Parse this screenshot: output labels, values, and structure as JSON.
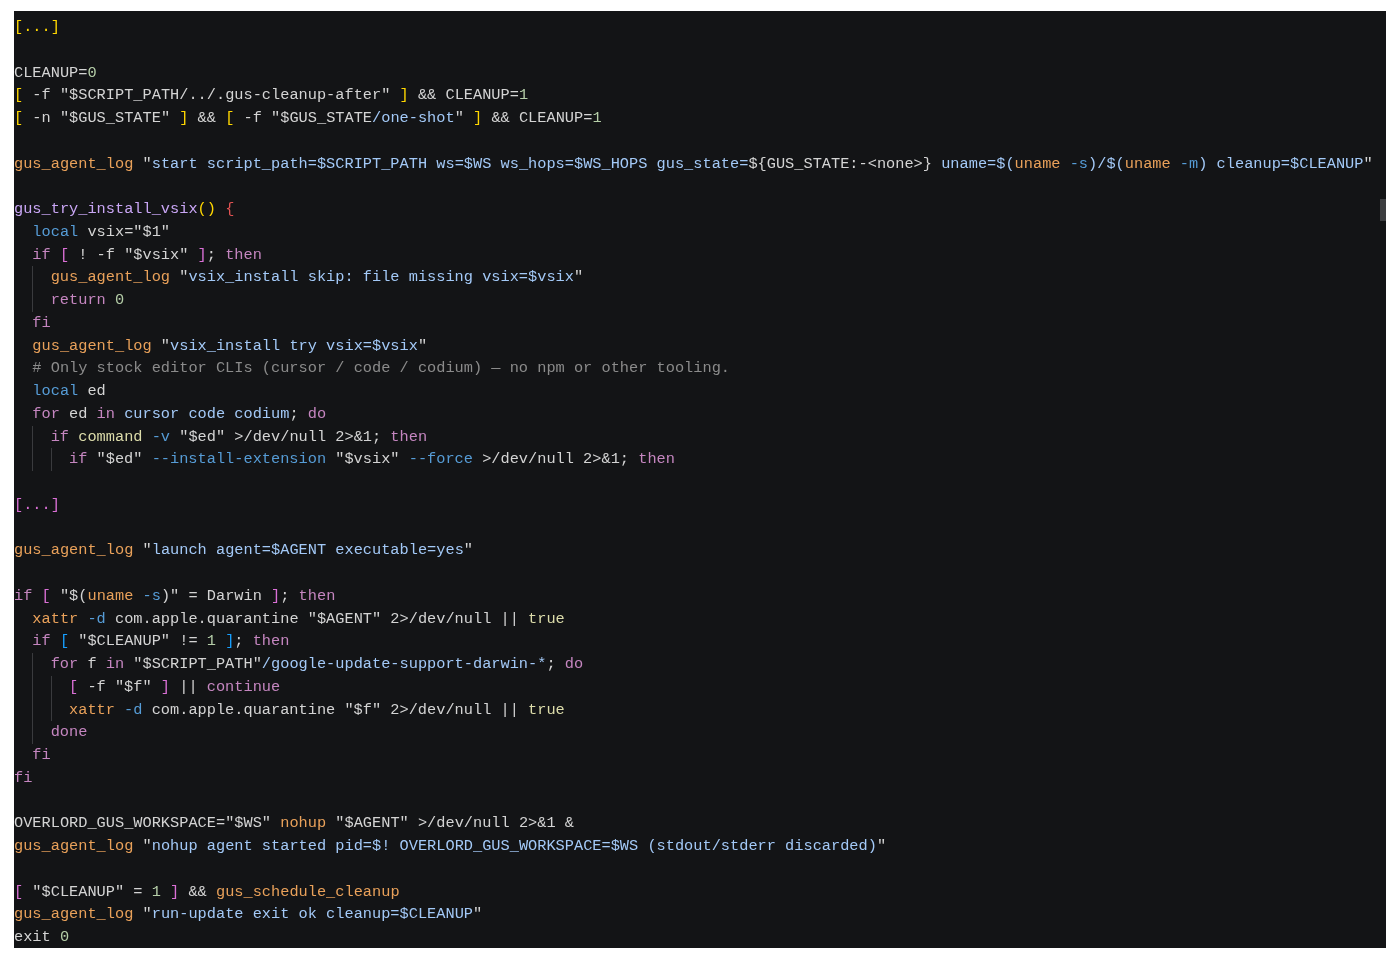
{
  "editor": {
    "lines": [
      {
        "kind": "code",
        "tokens": [
          {
            "text": "[...]",
            "kind": "b1"
          }
        ]
      },
      {
        "kind": "blank"
      },
      {
        "kind": "code",
        "tokens": [
          {
            "text": "CLEANUP=",
            "kind": "plain"
          },
          {
            "text": "0",
            "kind": "num"
          }
        ]
      },
      {
        "kind": "code",
        "tokens": [
          {
            "text": "[",
            "kind": "b1"
          },
          {
            "text": " -f \"$SCRIPT_PATH/../.gus-cleanup-after\" ",
            "kind": "plain"
          },
          {
            "text": "]",
            "kind": "b1"
          },
          {
            "text": " && CLEANUP=",
            "kind": "plain"
          },
          {
            "text": "1",
            "kind": "num"
          }
        ]
      },
      {
        "kind": "code",
        "tokens": [
          {
            "text": "[",
            "kind": "b1"
          },
          {
            "text": " -n \"$GUS_STATE\" ",
            "kind": "plain"
          },
          {
            "text": "]",
            "kind": "b1"
          },
          {
            "text": " && ",
            "kind": "plain"
          },
          {
            "text": "[",
            "kind": "b1"
          },
          {
            "text": " -f \"$GUS_STATE",
            "kind": "plain"
          },
          {
            "text": "/one-shot",
            "kind": "str"
          },
          {
            "text": "\" ",
            "kind": "plain"
          },
          {
            "text": "]",
            "kind": "b1"
          },
          {
            "text": " && CLEANUP=",
            "kind": "plain"
          },
          {
            "text": "1",
            "kind": "num"
          }
        ]
      },
      {
        "kind": "blank"
      },
      {
        "kind": "code",
        "tokens": [
          {
            "text": "gus_agent_log",
            "kind": "fn"
          },
          {
            "text": " \"",
            "kind": "plain"
          },
          {
            "text": "start script_path=$SCRIPT_PATH ws=$WS ws_hops=$WS_HOPS gus_state=",
            "kind": "str"
          },
          {
            "text": "${GUS_STATE:-<none>}",
            "kind": "plain"
          },
          {
            "text": " uname=$(",
            "kind": "str"
          },
          {
            "text": "uname",
            "kind": "fn"
          },
          {
            "text": " -s",
            "kind": "flag"
          },
          {
            "text": ")/$(",
            "kind": "str"
          },
          {
            "text": "uname",
            "kind": "fn"
          },
          {
            "text": " -m",
            "kind": "flag"
          },
          {
            "text": ")",
            "kind": "str"
          },
          {
            "text": " cleanup=$CLEANUP",
            "kind": "str"
          },
          {
            "text": "\"",
            "kind": "plain"
          }
        ]
      },
      {
        "kind": "blank"
      },
      {
        "kind": "code",
        "tokens": [
          {
            "text": "gus_try_install_vsix",
            "kind": "fndef"
          },
          {
            "text": "() ",
            "kind": "b1"
          },
          {
            "text": "{",
            "kind": "brace"
          }
        ]
      },
      {
        "kind": "code",
        "tokens": [
          {
            "text": "  local",
            "kind": "decl"
          },
          {
            "text": " vsix=\"$1\"",
            "kind": "plain"
          }
        ]
      },
      {
        "kind": "code",
        "tokens": [
          {
            "text": "  if ",
            "kind": "kw"
          },
          {
            "text": "[",
            "kind": "b2"
          },
          {
            "text": " ! -f \"$vsix\" ",
            "kind": "plain"
          },
          {
            "text": "]",
            "kind": "b2"
          },
          {
            "text": "; ",
            "kind": "plain"
          },
          {
            "text": "then",
            "kind": "kw"
          }
        ]
      },
      {
        "kind": "code",
        "tokens": [
          {
            "text": "    gus_agent_log",
            "kind": "fn"
          },
          {
            "text": " \"",
            "kind": "plain"
          },
          {
            "text": "vsix_install skip: file missing vsix=$vsix",
            "kind": "str"
          },
          {
            "text": "\"",
            "kind": "plain"
          }
        ]
      },
      {
        "kind": "code",
        "tokens": [
          {
            "text": "    return ",
            "kind": "kw"
          },
          {
            "text": "0",
            "kind": "num"
          }
        ]
      },
      {
        "kind": "code",
        "tokens": [
          {
            "text": "  fi",
            "kind": "kw"
          }
        ]
      },
      {
        "kind": "code",
        "tokens": [
          {
            "text": "  gus_agent_log",
            "kind": "fn"
          },
          {
            "text": " \"",
            "kind": "plain"
          },
          {
            "text": "vsix_install try vsix=$vsix",
            "kind": "str"
          },
          {
            "text": "\"",
            "kind": "plain"
          }
        ]
      },
      {
        "kind": "code",
        "tokens": [
          {
            "text": "  # Only stock editor CLIs (cursor / code / codium) — no npm or other tooling.",
            "kind": "comment"
          }
        ]
      },
      {
        "kind": "code",
        "tokens": [
          {
            "text": "  local",
            "kind": "decl"
          },
          {
            "text": " ed",
            "kind": "plain"
          }
        ]
      },
      {
        "kind": "code",
        "tokens": [
          {
            "text": "  for",
            "kind": "kw"
          },
          {
            "text": " ed ",
            "kind": "plain"
          },
          {
            "text": "in",
            "kind": "kw"
          },
          {
            "text": " cursor code codium",
            "kind": "str"
          },
          {
            "text": "; ",
            "kind": "plain"
          },
          {
            "text": "do",
            "kind": "kw"
          }
        ]
      },
      {
        "kind": "code",
        "tokens": [
          {
            "text": "    if ",
            "kind": "kw"
          },
          {
            "text": "command",
            "kind": "builtin"
          },
          {
            "text": " -v",
            "kind": "flag"
          },
          {
            "text": " \"$ed\" >/dev/null 2>&1; ",
            "kind": "plain"
          },
          {
            "text": "then",
            "kind": "kw"
          }
        ]
      },
      {
        "kind": "code",
        "tokens": [
          {
            "text": "      if",
            "kind": "kw"
          },
          {
            "text": " \"$ed\" ",
            "kind": "plain"
          },
          {
            "text": "--install-extension",
            "kind": "flag"
          },
          {
            "text": " \"$vsix\" ",
            "kind": "plain"
          },
          {
            "text": "--force",
            "kind": "flag"
          },
          {
            "text": " >/dev/null 2>&1; ",
            "kind": "plain"
          },
          {
            "text": "then",
            "kind": "kw"
          }
        ]
      },
      {
        "kind": "blank"
      },
      {
        "kind": "code",
        "tokens": [
          {
            "text": "[...]",
            "kind": "b2"
          }
        ]
      },
      {
        "kind": "blank"
      },
      {
        "kind": "code",
        "tokens": [
          {
            "text": "gus_agent_log",
            "kind": "fn"
          },
          {
            "text": " \"",
            "kind": "plain"
          },
          {
            "text": "launch agent=$AGENT executable=yes",
            "kind": "str"
          },
          {
            "text": "\"",
            "kind": "plain"
          }
        ]
      },
      {
        "kind": "blank"
      },
      {
        "kind": "code",
        "tokens": [
          {
            "text": "if ",
            "kind": "kw"
          },
          {
            "text": "[",
            "kind": "b2"
          },
          {
            "text": " \"$(",
            "kind": "plain"
          },
          {
            "text": "uname",
            "kind": "fn"
          },
          {
            "text": " -s",
            "kind": "flag"
          },
          {
            "text": ")\" = Darwin ",
            "kind": "plain"
          },
          {
            "text": "]",
            "kind": "b2"
          },
          {
            "text": "; ",
            "kind": "plain"
          },
          {
            "text": "then",
            "kind": "kw"
          }
        ]
      },
      {
        "kind": "code",
        "tokens": [
          {
            "text": "  xattr",
            "kind": "fn"
          },
          {
            "text": " -d",
            "kind": "flag"
          },
          {
            "text": " com.apple.quarantine \"$AGENT\" 2>/dev/null || ",
            "kind": "plain"
          },
          {
            "text": "true",
            "kind": "builtin"
          }
        ]
      },
      {
        "kind": "code",
        "tokens": [
          {
            "text": "  if ",
            "kind": "kw"
          },
          {
            "text": "[",
            "kind": "b3"
          },
          {
            "text": " \"$CLEANUP\" != ",
            "kind": "plain"
          },
          {
            "text": "1 ",
            "kind": "num"
          },
          {
            "text": "]",
            "kind": "b3"
          },
          {
            "text": "; ",
            "kind": "plain"
          },
          {
            "text": "then",
            "kind": "kw"
          }
        ]
      },
      {
        "kind": "code",
        "tokens": [
          {
            "text": "    for",
            "kind": "kw"
          },
          {
            "text": " f ",
            "kind": "plain"
          },
          {
            "text": "in",
            "kind": "kw"
          },
          {
            "text": " \"$SCRIPT_PATH\"",
            "kind": "plain"
          },
          {
            "text": "/google-update-support-darwin-*",
            "kind": "str"
          },
          {
            "text": "; ",
            "kind": "plain"
          },
          {
            "text": "do",
            "kind": "kw"
          }
        ]
      },
      {
        "kind": "code",
        "tokens": [
          {
            "text": "      [",
            "kind": "b2"
          },
          {
            "text": " -f \"$f\" ",
            "kind": "plain"
          },
          {
            "text": "]",
            "kind": "b2"
          },
          {
            "text": " || ",
            "kind": "plain"
          },
          {
            "text": "continue",
            "kind": "kw"
          }
        ]
      },
      {
        "kind": "code",
        "tokens": [
          {
            "text": "      xattr",
            "kind": "fn"
          },
          {
            "text": " -d",
            "kind": "flag"
          },
          {
            "text": " com.apple.quarantine \"$f\" 2>/dev/null || ",
            "kind": "plain"
          },
          {
            "text": "true",
            "kind": "builtin"
          }
        ]
      },
      {
        "kind": "code",
        "tokens": [
          {
            "text": "    done",
            "kind": "kw"
          }
        ]
      },
      {
        "kind": "code",
        "tokens": [
          {
            "text": "  fi",
            "kind": "kw"
          }
        ]
      },
      {
        "kind": "code",
        "tokens": [
          {
            "text": "fi",
            "kind": "kw"
          }
        ]
      },
      {
        "kind": "blank"
      },
      {
        "kind": "code",
        "tokens": [
          {
            "text": "OVERLORD_GUS_WORKSPACE=\"$WS\" ",
            "kind": "plain"
          },
          {
            "text": "nohup",
            "kind": "fn"
          },
          {
            "text": " \"$AGENT\" >/dev/null 2>&1 &",
            "kind": "plain"
          }
        ]
      },
      {
        "kind": "code",
        "tokens": [
          {
            "text": "gus_agent_log",
            "kind": "fn"
          },
          {
            "text": " \"",
            "kind": "plain"
          },
          {
            "text": "nohup agent started pid=$! OVERLORD_GUS_WORKSPACE=$WS (stdout/stderr discarded)",
            "kind": "str"
          },
          {
            "text": "\"",
            "kind": "plain"
          }
        ]
      },
      {
        "kind": "blank"
      },
      {
        "kind": "code",
        "tokens": [
          {
            "text": "[",
            "kind": "b2"
          },
          {
            "text": " \"$CLEANUP\" = ",
            "kind": "plain"
          },
          {
            "text": "1 ",
            "kind": "num"
          },
          {
            "text": "]",
            "kind": "b2"
          },
          {
            "text": " && ",
            "kind": "plain"
          },
          {
            "text": "gus_schedule_cleanup",
            "kind": "fn"
          }
        ]
      },
      {
        "kind": "code",
        "tokens": [
          {
            "text": "gus_agent_log",
            "kind": "fn"
          },
          {
            "text": " \"",
            "kind": "plain"
          },
          {
            "text": "run-update exit ok cleanup=$CLEANUP",
            "kind": "str"
          },
          {
            "text": "\"",
            "kind": "plain"
          }
        ]
      },
      {
        "kind": "code",
        "tokens": [
          {
            "text": "exit ",
            "kind": "plain"
          },
          {
            "text": "0",
            "kind": "num"
          }
        ]
      }
    ]
  }
}
